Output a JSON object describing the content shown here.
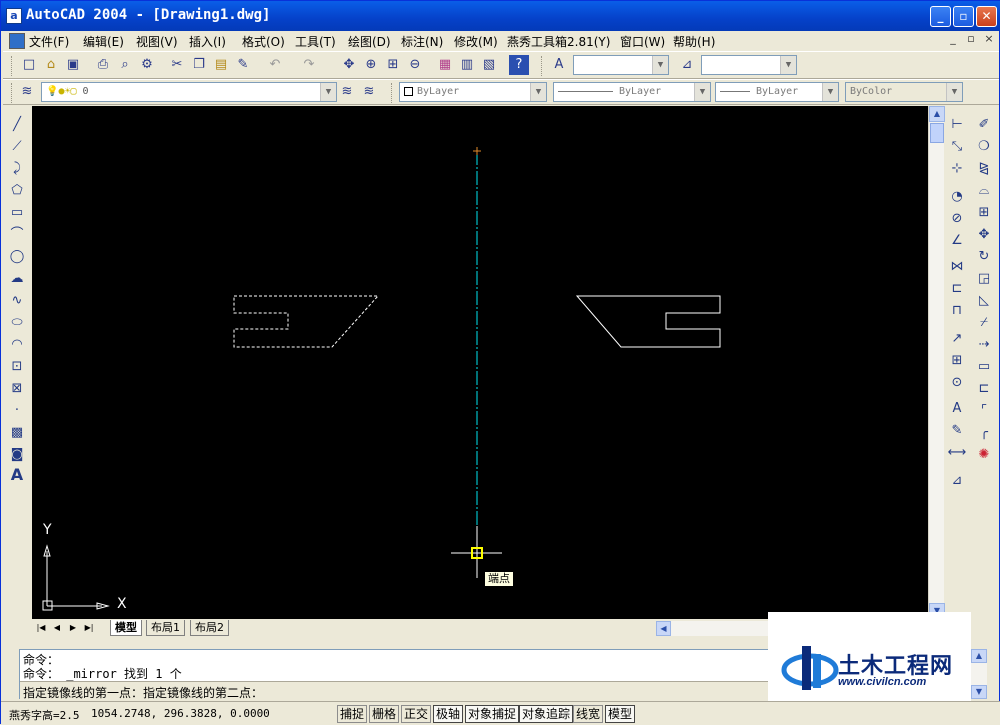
{
  "window": {
    "title": "AutoCAD 2004 - [Drawing1.dwg]",
    "app_icon_glyph": "a",
    "colors": {
      "titlebar": "#0a5ee8",
      "canvas": "#000000",
      "mirror_line": "#00ffff",
      "selected_dashed": "#ffffff"
    }
  },
  "menu": {
    "items": [
      {
        "label": "文件(F)"
      },
      {
        "label": "编辑(E)"
      },
      {
        "label": "视图(V)"
      },
      {
        "label": "插入(I)"
      },
      {
        "label": "格式(O)"
      },
      {
        "label": "工具(T)"
      },
      {
        "label": "绘图(D)"
      },
      {
        "label": "标注(N)"
      },
      {
        "label": "修改(M)"
      },
      {
        "label": "燕秀工具箱2.81(Y)"
      },
      {
        "label": "窗口(W)"
      },
      {
        "label": "帮助(H)"
      }
    ],
    "doc_buttons": [
      "_",
      "▫",
      "×"
    ]
  },
  "properties_toolbar": {
    "layer_value": "0",
    "color_value": "ByLayer",
    "linetype_value": "ByLayer",
    "lineweight_value": "ByLayer",
    "plotstyle_value": "ByColor"
  },
  "canvas": {
    "ucs_x_label": "X",
    "ucs_y_label": "Y",
    "snap_tooltip": "端点"
  },
  "tabs": {
    "items": [
      {
        "label": "模型"
      },
      {
        "label": "布局1"
      },
      {
        "label": "布局2"
      }
    ],
    "active": "模型"
  },
  "command": {
    "line1": "命令：",
    "line2": "命令：  _mirror 找到 1 个",
    "line3": "指定镜像线的第一点：指定镜像线的第二点："
  },
  "status": {
    "text_height": "燕秀字高=2.5",
    "coordinates": "1054.2748, 296.3828, 0.0000",
    "buttons": [
      {
        "label": "捕捉",
        "on": false
      },
      {
        "label": "栅格",
        "on": false
      },
      {
        "label": "正交",
        "on": false
      },
      {
        "label": "极轴",
        "on": true
      },
      {
        "label": "对象捕捉",
        "on": true
      },
      {
        "label": "对象追踪",
        "on": true
      },
      {
        "label": "线宽",
        "on": false
      },
      {
        "label": "模型",
        "on": true
      }
    ]
  },
  "watermark": {
    "name": "土木工程网",
    "url": "www.civilcn.com"
  }
}
